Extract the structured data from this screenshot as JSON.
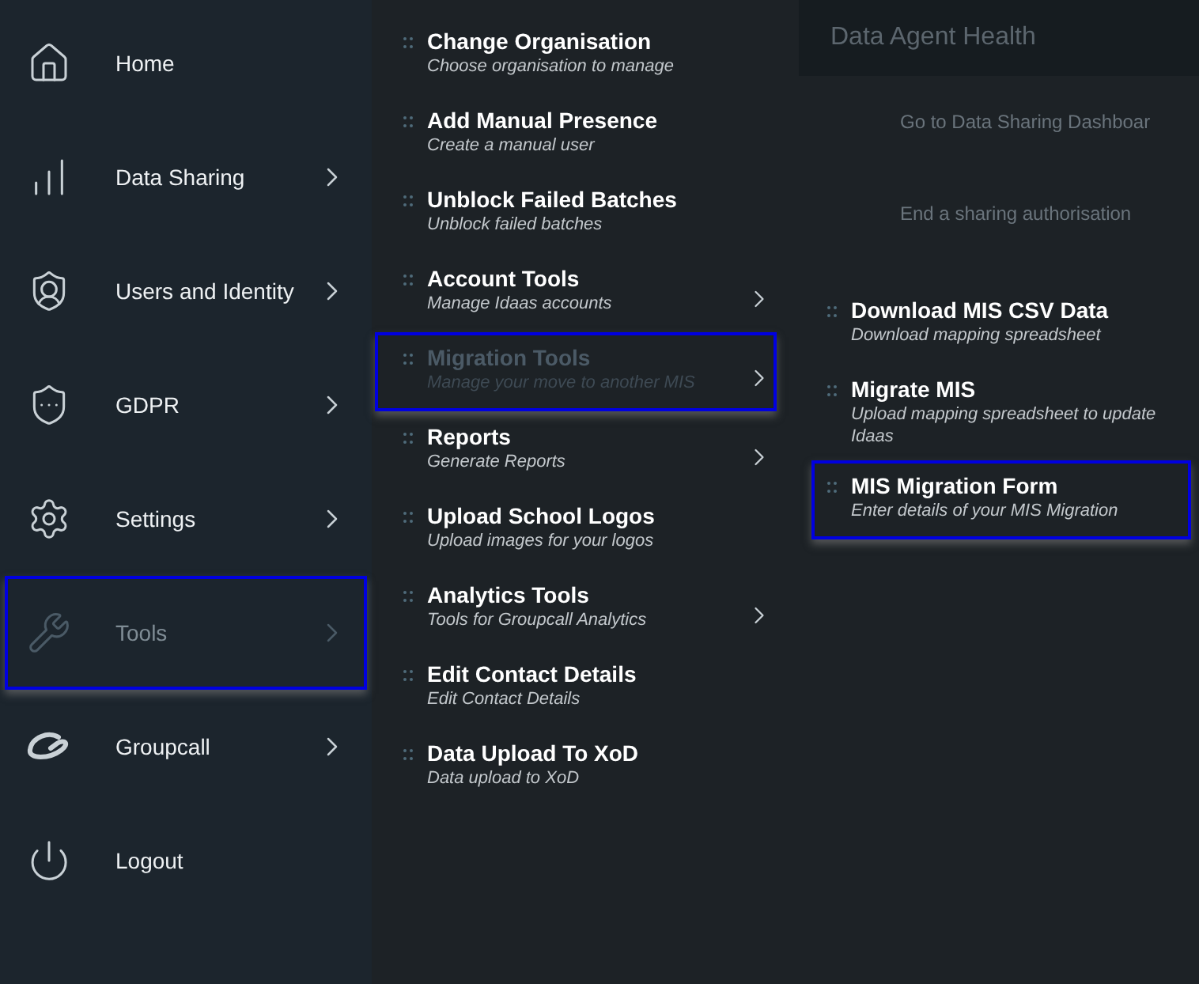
{
  "sidebar": {
    "items": [
      {
        "kind": "home",
        "label": "Home",
        "has_arrow": false,
        "selected": false
      },
      {
        "kind": "data",
        "label": "Data Sharing",
        "has_arrow": true,
        "selected": false
      },
      {
        "kind": "user",
        "label": "Users and Identity",
        "has_arrow": true,
        "selected": false
      },
      {
        "kind": "lock",
        "label": "GDPR",
        "has_arrow": true,
        "selected": false
      },
      {
        "kind": "gear",
        "label": "Settings",
        "has_arrow": true,
        "selected": false
      },
      {
        "kind": "tools",
        "label": "Tools",
        "has_arrow": true,
        "selected": true
      },
      {
        "kind": "logo",
        "label": "Groupcall",
        "has_arrow": true,
        "selected": false
      },
      {
        "kind": "power",
        "label": "Logout",
        "has_arrow": false,
        "selected": false
      }
    ]
  },
  "background": {
    "header": "Data Agent Health",
    "links": [
      "Go to Data Sharing Dashboar",
      "End a sharing authorisation"
    ]
  },
  "tools_menu": {
    "items": [
      {
        "title": "Change Organisation",
        "subtitle": "Choose organisation to manage",
        "has_arrow": false,
        "selected": false
      },
      {
        "title": "Add Manual Presence",
        "subtitle": "Create a manual user",
        "has_arrow": false,
        "selected": false
      },
      {
        "title": "Unblock Failed Batches",
        "subtitle": "Unblock failed batches",
        "has_arrow": false,
        "selected": false
      },
      {
        "title": "Account Tools",
        "subtitle": "Manage Idaas accounts",
        "has_arrow": true,
        "selected": false
      },
      {
        "title": "Migration Tools",
        "subtitle": "Manage your move to another MIS",
        "has_arrow": true,
        "selected": true
      },
      {
        "title": "Reports",
        "subtitle": "Generate Reports",
        "has_arrow": true,
        "selected": false
      },
      {
        "title": "Upload School Logos",
        "subtitle": "Upload images for your logos",
        "has_arrow": false,
        "selected": false
      },
      {
        "title": "Analytics Tools",
        "subtitle": "Tools for Groupcall Analytics",
        "has_arrow": true,
        "selected": false
      },
      {
        "title": "Edit Contact Details",
        "subtitle": "Edit Contact Details",
        "has_arrow": false,
        "selected": false
      },
      {
        "title": "Data Upload To XoD",
        "subtitle": "Data upload to XoD",
        "has_arrow": false,
        "selected": false
      }
    ]
  },
  "migration_menu": {
    "items": [
      {
        "title": "Download MIS CSV Data",
        "subtitle": "Download mapping spreadsheet",
        "selected": false
      },
      {
        "title": "Migrate MIS",
        "subtitle": "Upload mapping spreadsheet to update Idaas",
        "selected": false
      },
      {
        "title": "MIS Migration Form",
        "subtitle": "Enter details of your MIS Migration",
        "selected": true
      }
    ]
  }
}
